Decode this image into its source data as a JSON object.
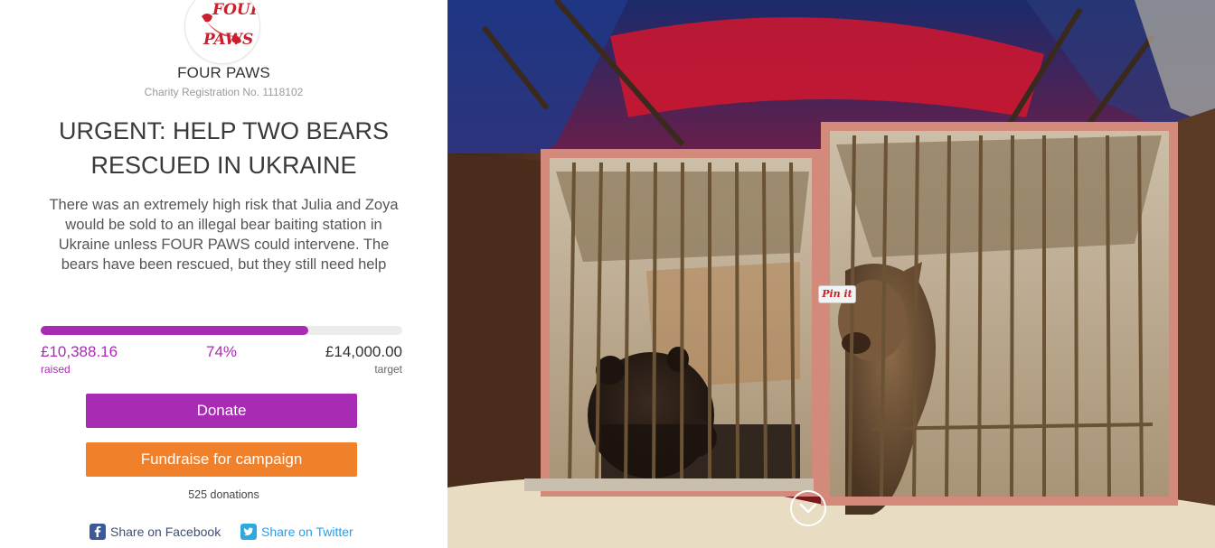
{
  "org": {
    "logo_text_line1": "FOUR",
    "logo_text_line2": "PAWS",
    "name": "FOUR PAWS",
    "registration": "Charity Registration No. 1118102",
    "brand_color": "#cc1f2d"
  },
  "campaign": {
    "title": "URGENT: HELP TWO BEARS RESCUED IN UKRAINE",
    "description": "There was an extremely high risk that Julia and Zoya would be sold to an illegal bear baiting station in Ukraine unless FOUR PAWS could intervene. The bears have been rescued, but they still need help"
  },
  "progress": {
    "raised": "£10,388.16",
    "raised_label": "raised",
    "percent_text": "74%",
    "percent_value": 74,
    "target": "£14,000.00",
    "target_label": "target",
    "accent_color": "#a82cb3"
  },
  "actions": {
    "donate_label": "Donate",
    "fundraise_label": "Fundraise for campaign",
    "fundraise_color": "#f0812a"
  },
  "stats": {
    "donations": "525 donations"
  },
  "share": {
    "facebook": "Share on Facebook",
    "twitter": "Share on Twitter",
    "facebook_icon": "facebook-icon",
    "twitter_icon": "twitter-icon"
  },
  "hero": {
    "pin_label": "Pin it",
    "scroll_icon": "chevron-down-icon"
  }
}
